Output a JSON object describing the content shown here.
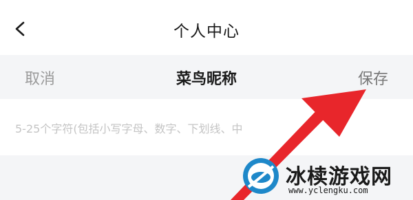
{
  "nav": {
    "back_icon": "chevron-left-icon",
    "title": "个人中心"
  },
  "dialog": {
    "cancel_label": "取消",
    "title": "菜鸟昵称",
    "save_label": "保存"
  },
  "input": {
    "hint": "5-25个字符(包括小写字母、数字、下划线、中"
  },
  "annotation": {
    "arrow_color": "#e8262b"
  },
  "watermark": {
    "name": "冰椟游戏网",
    "url": "www.yclengku.com"
  },
  "colors": {
    "header_bg": "#f4f5f7",
    "primary_text": "#1a1a1a",
    "muted_text": "#9a9a9a",
    "hint_text": "#c4c4c4"
  }
}
